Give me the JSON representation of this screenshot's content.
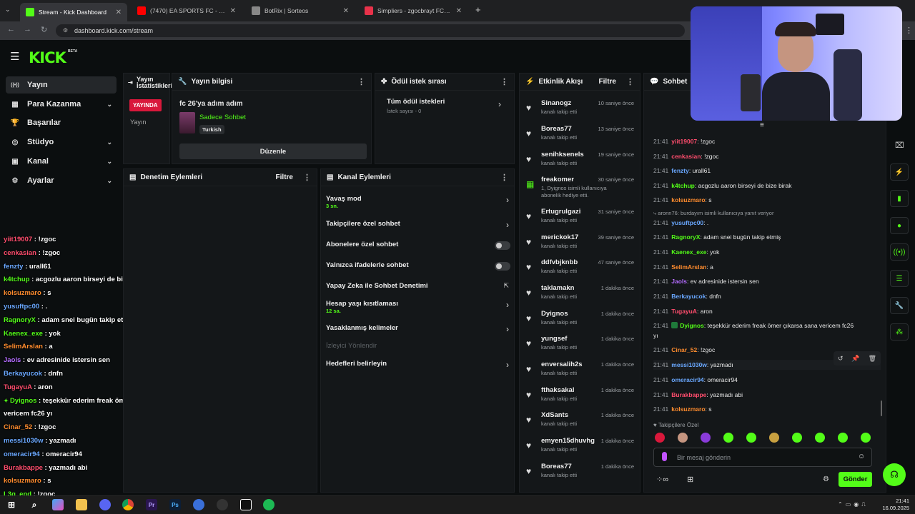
{
  "browser": {
    "tabs": [
      {
        "label": "Stream - Kick Dashboard",
        "color": "#53fc18"
      },
      {
        "label": "(7470) EA SPORTS FC - YouTub",
        "color": "#ff0000"
      },
      {
        "label": "BotRix | Sorteos",
        "color": "#888888"
      },
      {
        "label": "Simpliers - zgocbrayt FC 26 2 a",
        "color": "#e8324a"
      }
    ],
    "url": "dashboard.kick.com/stream"
  },
  "brand": {
    "logo": "KICK",
    "beta": "BETA",
    "accent": "#53fc18"
  },
  "sidebar": {
    "items": [
      {
        "label": "Yayın",
        "icon": "broadcast-icon"
      },
      {
        "label": "Para Kazanma",
        "icon": "money-icon"
      },
      {
        "label": "Başarılar",
        "icon": "trophy-icon"
      },
      {
        "label": "Stüdyo",
        "icon": "studio-icon"
      },
      {
        "label": "Kanal",
        "icon": "channel-icon"
      },
      {
        "label": "Ayarlar",
        "icon": "gear-icon"
      }
    ]
  },
  "overlay_chat": [
    {
      "user": "yiit19007",
      "msg": "!zgoc",
      "color": "#ff4d6d"
    },
    {
      "user": "cenkasian",
      "msg": "!zgoc",
      "color": "#ff4d6d"
    },
    {
      "user": "fenzty",
      "msg": "urall61",
      "color": "#6aa8ff"
    },
    {
      "user": "k4tchup",
      "msg": "acgozlu aaron birseyi de bize birak",
      "color": "#53fc18"
    },
    {
      "user": "kolsuzmaro",
      "msg": "s",
      "color": "#ff8c2e"
    },
    {
      "user": "yusuftpc00",
      "msg": ".",
      "color": "#6aa8ff"
    },
    {
      "user": "RagnoryX",
      "msg": "adam snei bugün takip etmiş",
      "color": "#53fc18"
    },
    {
      "user": "Kaenex_exe",
      "msg": "yok",
      "color": "#53fc18"
    },
    {
      "user": "SelimArslan",
      "msg": "a",
      "color": "#ff8c2e"
    },
    {
      "user": "Jaols",
      "msg": "ev adresinide istersin sen",
      "color": "#b46cff"
    },
    {
      "user": "Berkayucok",
      "msg": "dnfn",
      "color": "#6aa8ff"
    },
    {
      "user": "TugayuA",
      "msg": "aron",
      "color": "#ff4d6d"
    },
    {
      "user": "Dyignos",
      "msg": "teşekkür ederim freak ömer çıkarsa sana",
      "color": "#53fc18"
    },
    {
      "user": "",
      "msg": "vericem fc26 yı",
      "color": "#ffffff"
    },
    {
      "user": "Cinar_52",
      "msg": "!zgoc",
      "color": "#ff8c2e"
    },
    {
      "user": "messi1030w",
      "msg": "yazmadı",
      "color": "#6aa8ff"
    },
    {
      "user": "omeracir94",
      "msg": "omeracir94",
      "color": "#6aa8ff"
    },
    {
      "user": "Burakbappe",
      "msg": "yazmadı abi",
      "color": "#ff4d6d"
    },
    {
      "user": "kolsuzmaro",
      "msg": "s",
      "color": "#ff8c2e"
    },
    {
      "user": "L3g_end",
      "msg": "!zgoc",
      "color": "#53fc18"
    }
  ],
  "stats_panel": {
    "title": "Yayın İstatistikleri",
    "live_badge": "YAYINDA",
    "label": "Yayın"
  },
  "info_panel": {
    "title": "Yayın bilgisi",
    "stream_title": "fc 26'ya adım adım",
    "category": "Sadece Sohbet",
    "language": "Turkish",
    "edit_button": "Düzenle"
  },
  "rewards_panel": {
    "title": "Ödül istek sırası",
    "item": "Tüm ödül istekleri",
    "count": "İstek sayısı - 0"
  },
  "moderation_panel": {
    "title": "Denetim Eylemleri",
    "filter": "Filtre"
  },
  "channel_actions": {
    "title": "Kanal Eylemleri",
    "items": [
      {
        "label": "Yavaş mod",
        "sub": "3 sn.",
        "control": "arrow"
      },
      {
        "label": "Takipçilere özel sohbet",
        "sub": "",
        "control": "arrow"
      },
      {
        "label": "Abonelere özel sohbet",
        "sub": "",
        "control": "toggle"
      },
      {
        "label": "Yalnızca ifadelerle sohbet",
        "sub": "",
        "control": "toggle"
      },
      {
        "label": "Yapay Zeka ile Sohbet Denetimi",
        "sub": "",
        "control": "external"
      },
      {
        "label": "Hesap yaşı kısıtlaması",
        "sub": "12 sa.",
        "control": "arrow"
      },
      {
        "label": "Yasaklanmış kelimeler",
        "sub": "",
        "control": "arrow"
      },
      {
        "label": "İzleyici Yönlendir",
        "sub": "",
        "control": "none"
      },
      {
        "label": "Hedefleri belirleyin",
        "sub": "",
        "control": "arrow"
      }
    ]
  },
  "activity": {
    "title": "Etkinlik Akışı",
    "filter": "Filtre",
    "items": [
      {
        "name": "Sinanogz",
        "sub": "kanalı takip etti",
        "time": "10 saniye önce"
      },
      {
        "name": "Boreas77",
        "sub": "kanalı takip etti",
        "time": "13 saniye önce"
      },
      {
        "name": "senihksenels",
        "sub": "kanalı takip etti",
        "time": "19 saniye önce"
      },
      {
        "name": "freakomer",
        "sub": "1, Dyignos isimli kullanıcıya abonelik hediye etti.",
        "time": "30 saniye önce",
        "gift": true
      },
      {
        "name": "Ertugrulgazi",
        "sub": "kanalı takip etti",
        "time": "31 saniye önce"
      },
      {
        "name": "merickok17",
        "sub": "kanalı takip etti",
        "time": "39 saniye önce"
      },
      {
        "name": "ddfvbjknbb",
        "sub": "kanalı takip etti",
        "time": "47 saniye önce"
      },
      {
        "name": "taklamakn",
        "sub": "kanalı takip etti",
        "time": "1 dakika önce"
      },
      {
        "name": "Dyignos",
        "sub": "kanalı takip etti",
        "time": "1 dakika önce"
      },
      {
        "name": "yungsef",
        "sub": "kanalı takip etti",
        "time": "1 dakika önce"
      },
      {
        "name": "enversalih2s",
        "sub": "kanalı takip etti",
        "time": "1 dakika önce"
      },
      {
        "name": "fthaksakal",
        "sub": "kanalı takip etti",
        "time": "1 dakika önce"
      },
      {
        "name": "XdSants",
        "sub": "kanalı takip etti",
        "time": "1 dakika önce"
      },
      {
        "name": "emyen15dhuvhg",
        "sub": "kanalı takip etti",
        "time": "1 dakika önce"
      },
      {
        "name": "Boreas77",
        "sub": "kanalı takip etti",
        "time": "1 dakika önce"
      }
    ]
  },
  "chat": {
    "title": "Sohbet",
    "messages": [
      {
        "time": "21:41",
        "user": "yiit19007",
        "msg": "!zgoc",
        "color": "#ff4d6d"
      },
      {
        "time": "21:41",
        "user": "cenkasian",
        "msg": "!zgoc",
        "color": "#ff4d6d"
      },
      {
        "time": "21:41",
        "user": "fenzty",
        "msg": "urall61",
        "color": "#6aa8ff"
      },
      {
        "time": "21:41",
        "user": "k4tchup",
        "msg": "acgozlu aaron birseyi de bize birak",
        "color": "#53fc18"
      },
      {
        "time": "21:41",
        "user": "kolsuzmaro",
        "msg": "s",
        "color": "#ff8c2e"
      },
      {
        "time": "",
        "user": "",
        "msg": "aronn76: burdayım isimli kullanıcıya yanıt veriyor",
        "color": "#9ca0a4",
        "reply": true
      },
      {
        "time": "21:41",
        "user": "yusuftpc00",
        "msg": ".",
        "color": "#6aa8ff"
      },
      {
        "time": "21:41",
        "user": "RagnoryX",
        "msg": "adam snei bugün takip etmiş",
        "color": "#53fc18"
      },
      {
        "time": "21:41",
        "user": "Kaenex_exe",
        "msg": "yok",
        "color": "#53fc18"
      },
      {
        "time": "21:41",
        "user": "SelimArslan",
        "msg": "a",
        "color": "#ff8c2e"
      },
      {
        "time": "21:41",
        "user": "Jaols",
        "msg": "ev adresinide istersin sen",
        "color": "#b46cff"
      },
      {
        "time": "21:41",
        "user": "Berkayucok",
        "msg": "dnfn",
        "color": "#6aa8ff"
      },
      {
        "time": "21:41",
        "user": "TugayuA",
        "msg": "aron",
        "color": "#ff4d6d"
      },
      {
        "time": "21:41",
        "user": "Dyignos",
        "msg": "teşekkür ederim freak ömer çıkarsa sana vericem fc26",
        "color": "#53fc18"
      },
      {
        "time": "",
        "user": "",
        "msg": "yı",
        "color": "#e8e8e8",
        "cont": true
      },
      {
        "time": "21:41",
        "user": "Cinar_52",
        "msg": "!zgoc",
        "color": "#ff8c2e"
      },
      {
        "time": "21:41",
        "user": "messi1030w",
        "msg": "yazmadı",
        "color": "#6aa8ff"
      },
      {
        "time": "21:41",
        "user": "omeracir94",
        "msg": "omeracir94",
        "color": "#6aa8ff"
      },
      {
        "time": "21:41",
        "user": "Burakbappe",
        "msg": "yazmadı abi",
        "color": "#ff4d6d"
      },
      {
        "time": "21:41",
        "user": "kolsuzmaro",
        "msg": "s",
        "color": "#ff8c2e"
      }
    ],
    "mode_label": "Takipçilere Özel",
    "placeholder": "Bir mesaj gönderin",
    "send_button": "Gönder"
  },
  "clock": {
    "time": "21:41",
    "date": "16.09.2025"
  }
}
